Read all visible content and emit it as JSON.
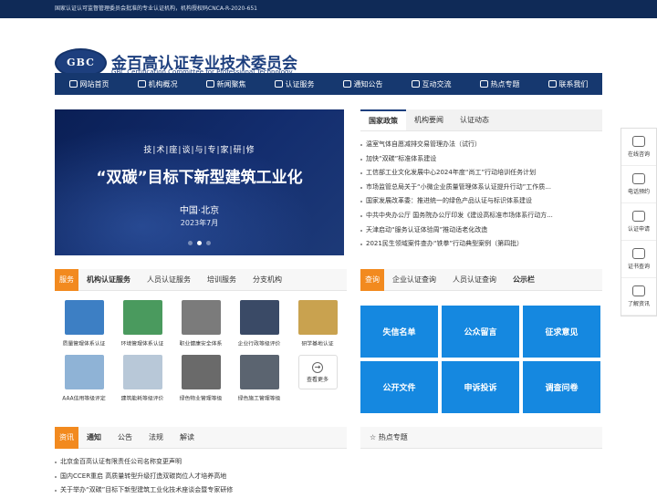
{
  "topbar": {
    "text": "国家认证认可监督管理委员会批准的专业认证机构，机构授权码CNCA-R-2020-651"
  },
  "header": {
    "logo": "GBC",
    "name_cn": "金百高认证专业技术委员会",
    "name_en": "GBC Certification Committee for Professional Technology"
  },
  "nav": [
    {
      "label": "网站首页",
      "icon": "home-icon"
    },
    {
      "label": "机构概况",
      "icon": "building-icon"
    },
    {
      "label": "新闻聚焦",
      "icon": "megaphone-icon"
    },
    {
      "label": "认证服务",
      "icon": "monitor-icon"
    },
    {
      "label": "通知公告",
      "icon": "mail-icon"
    },
    {
      "label": "互动交流",
      "icon": "edit-icon"
    },
    {
      "label": "热点专题",
      "icon": "fire-icon"
    },
    {
      "label": "联系我们",
      "icon": "phone-icon"
    }
  ],
  "banner": {
    "tag": "技|术|座|谈|与|专|家|研|修",
    "title": "“双碳”目标下新型建筑工业化",
    "city": "中国·北京",
    "date": "2023年7月"
  },
  "news_tabs": [
    "国家政策",
    "机构要闻",
    "认证动态"
  ],
  "news": [
    "温室气体自愿减排交易管理办法（试行）",
    "加快“双碳”标准体系建设",
    "工信部工业文化发展中心2024年度“尚工”行动培训任务计划",
    "市场监管总局关于“小微企业质量管理体系认证提升行动”工作质...",
    "国家发展改革委：推进统一的绿色产品认证与标识体系建设",
    "中共中央办公厅 国务院办公厅印发《建设高标准市场体系行动方...",
    "天津启动“服务认证体验周”推动适老化改造",
    "2021民生领域案件查办“铁拳”行动典型案例（第四批）"
  ],
  "services": {
    "tag": "服务",
    "tabs": [
      "机构认证服务",
      "人员认证服务",
      "培训服务",
      "分支机构"
    ],
    "items": [
      {
        "caption": "质量管理体系认证",
        "color": "#3d7fc4"
      },
      {
        "caption": "环境管理体系认证",
        "color": "#4a9a5e"
      },
      {
        "caption": "职业健康安全体系",
        "color": "#7b7b7b"
      },
      {
        "caption": "企业行政等级评价",
        "color": "#3a4a66"
      },
      {
        "caption": "研学基地认证",
        "color": "#c9a24f"
      },
      {
        "caption": "AAA信用等级评定",
        "color": "#8fb3d6"
      },
      {
        "caption": "建筑能耗等级评价",
        "color": "#b8c8d8"
      },
      {
        "caption": "绿色物业管理等级",
        "color": "#6a6a6a"
      },
      {
        "caption": "绿色施工管理等级",
        "color": "#5b6470"
      }
    ],
    "more_label": "查看更多"
  },
  "query": {
    "tag": "查询",
    "tabs": [
      "企业认证查询",
      "人员认证查询",
      "公示栏"
    ],
    "tiles": [
      "失信名单",
      "公众留言",
      "征求意见",
      "公开文件",
      "申诉投诉",
      "调查问卷"
    ]
  },
  "news2": {
    "tag": "资讯",
    "tabs": [
      "通知",
      "公告",
      "法规",
      "解读"
    ],
    "items": [
      "北京金百高认证有限责任公司名称变更声明",
      "国内CCER重启 高质量转型升级打造双碳岗位人才培养高地",
      "关于举办“双碳”目标下新型建筑工业化技术座谈会暨专家研修"
    ]
  },
  "hot": {
    "title": "热点专题"
  },
  "float_bar": [
    "在线咨询",
    "电话预约",
    "认证申请",
    "证书查询",
    "了解资讯"
  ]
}
